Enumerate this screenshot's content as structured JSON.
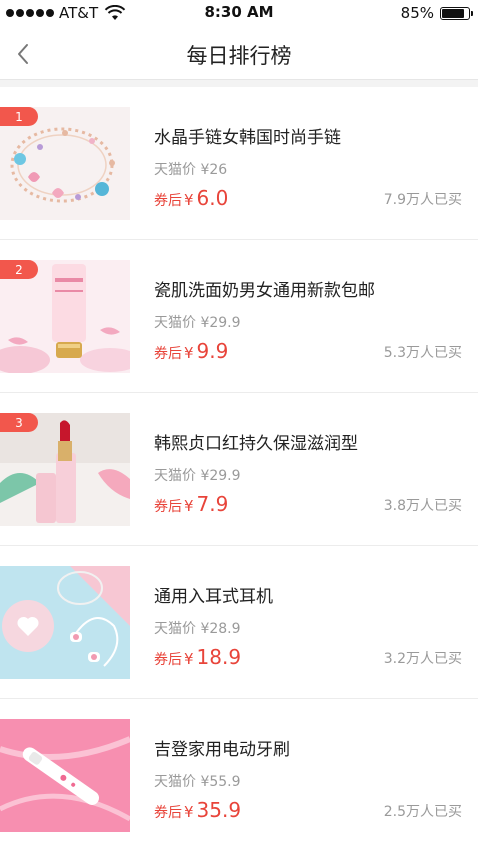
{
  "status_bar": {
    "carrier": "AT&T",
    "time": "8:30 AM",
    "battery_text": "85%",
    "battery_level": 0.85
  },
  "nav": {
    "title": "每日排行榜",
    "back_icon": "chevron-left-icon"
  },
  "products": [
    {
      "rank": "1",
      "title": "水晶手链女韩国时尚手链",
      "original_price": "天猫价 ¥26",
      "coupon_label": "券后",
      "currency": "¥",
      "price": "6.0",
      "sold": "7.9万人已买"
    },
    {
      "rank": "2",
      "title": "瓷肌洗面奶男女通用新款包邮",
      "original_price": "天猫价 ¥29.9",
      "coupon_label": "券后",
      "currency": "¥",
      "price": "9.9",
      "sold": "5.3万人已买"
    },
    {
      "rank": "3",
      "title": "韩熙贞口红持久保湿滋润型",
      "original_price": "天猫价 ¥29.9",
      "coupon_label": "券后",
      "currency": "¥",
      "price": "7.9",
      "sold": "3.8万人已买"
    },
    {
      "rank": "",
      "title": "通用入耳式耳机",
      "original_price": "天猫价 ¥28.9",
      "coupon_label": "券后",
      "currency": "¥",
      "price": "18.9",
      "sold": "3.2万人已买"
    },
    {
      "rank": "",
      "title": "吉登家用电动牙刷",
      "original_price": "天猫价 ¥55.9",
      "coupon_label": "券后",
      "currency": "¥",
      "price": "35.9",
      "sold": "2.5万人已买"
    }
  ],
  "colors": {
    "accent_red": "#e8443a",
    "rank_badge": "#f2574c",
    "muted_text": "#9a9a9a"
  }
}
